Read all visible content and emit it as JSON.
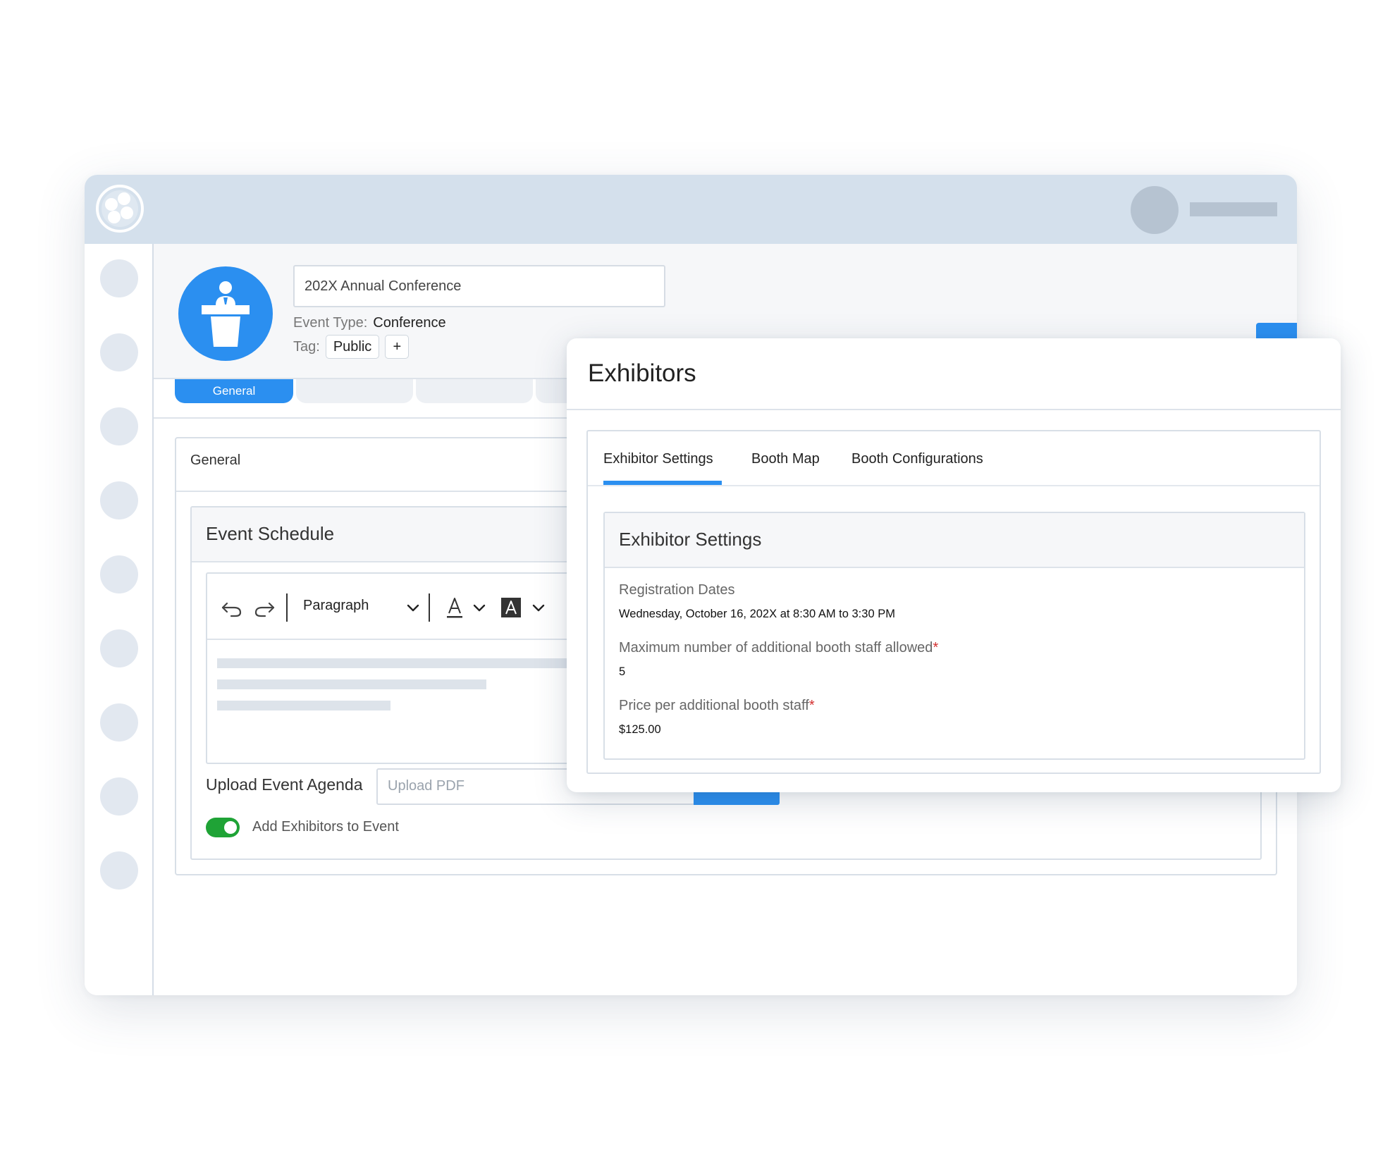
{
  "header": {
    "event_name": "202X Annual Conference",
    "event_type_label": "Event Type:",
    "event_type_value": "Conference",
    "tag_label": "Tag:",
    "tag_value": "Public",
    "add_tag": "+"
  },
  "tabs": {
    "active_label": "General"
  },
  "general": {
    "title": "General",
    "schedule": {
      "title": "Event Schedule",
      "paragraph_style": "Paragraph",
      "upload_label": "Upload Event Agenda",
      "upload_placeholder": "Upload PDF",
      "toggle_label": "Add Exhibitors to Event"
    }
  },
  "modal": {
    "title": "Exhibitors",
    "tabs": [
      "Exhibitor Settings",
      "Booth Map",
      "Booth Configurations"
    ],
    "settings": {
      "title": "Exhibitor Settings",
      "registration_label": "Registration Dates",
      "registration_value": "Wednesday, October 16, 202X at 8:30 AM to 3:30 PM",
      "max_staff_label": "Maximum number of additional booth staff allowed",
      "max_staff_value": "5",
      "price_label": "Price per additional booth staff",
      "price_value": "$125.00",
      "required_mark": "*"
    }
  },
  "colors": {
    "accent": "#2b8ff0",
    "toggle_on": "#1fa336",
    "required": "#d32f2f"
  },
  "icons": [
    "logo-icon",
    "podium-icon",
    "undo-icon",
    "redo-icon",
    "chevron-down-icon",
    "font-color-icon",
    "highlight-color-icon"
  ]
}
